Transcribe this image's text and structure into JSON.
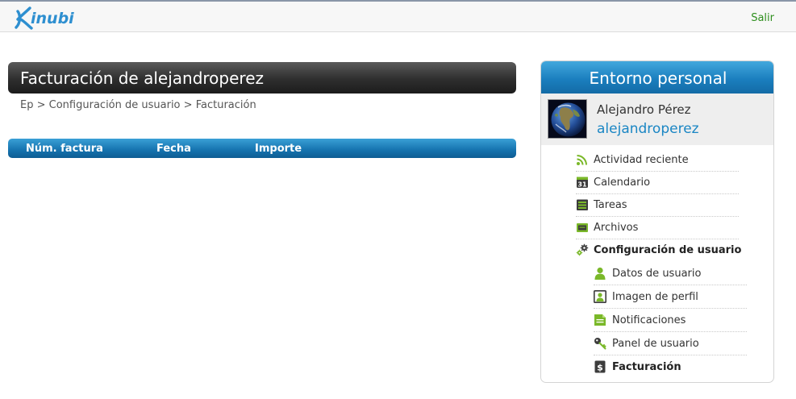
{
  "header": {
    "logo_text": "Kinubi",
    "logout_label": "Salir"
  },
  "main": {
    "title": "Facturación de alejandroperez",
    "breadcrumb": [
      "Ep",
      "Configuración de usuario",
      "Facturación"
    ],
    "breadcrumb_separator": ">",
    "table": {
      "columns": [
        "Núm. factura",
        "Fecha",
        "Importe"
      ],
      "rows": []
    }
  },
  "sidebar": {
    "title": "Entorno personal",
    "user": {
      "full_name": "Alejandro Pérez",
      "username": "alejandroperez"
    },
    "menu": [
      {
        "label": "Actividad reciente",
        "icon": "rss-icon"
      },
      {
        "label": "Calendario",
        "icon": "calendar-icon",
        "icon_text": "31"
      },
      {
        "label": "Tareas",
        "icon": "tasks-icon"
      },
      {
        "label": "Archivos",
        "icon": "files-icon"
      },
      {
        "label": "Configuración de usuario",
        "icon": "gears-icon",
        "active": true
      }
    ],
    "submenu": [
      {
        "label": "Datos de usuario",
        "icon": "user-icon"
      },
      {
        "label": "Imagen de perfil",
        "icon": "profile-image-icon"
      },
      {
        "label": "Notificaciones",
        "icon": "notifications-icon"
      },
      {
        "label": "Panel de usuario",
        "icon": "key-icon"
      },
      {
        "label": "Facturación",
        "icon": "billing-icon",
        "icon_text": "$",
        "active": true
      }
    ]
  },
  "colors": {
    "accent_blue": "#1b7fbf",
    "link_green": "#2f8f1f",
    "title_dark": "#2e2e2e"
  }
}
